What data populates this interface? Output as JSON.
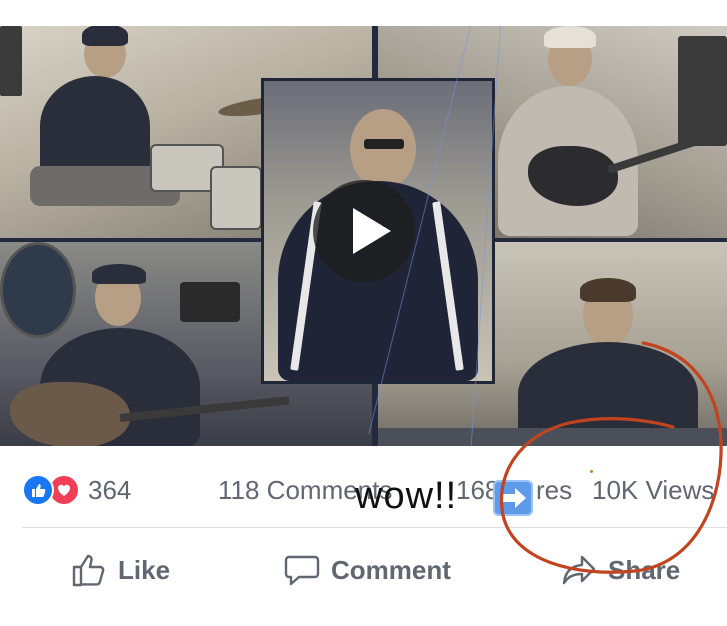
{
  "post": {
    "video": {
      "play_button_label": "Play"
    },
    "reactions": {
      "count": "364",
      "types": [
        "like",
        "love"
      ]
    },
    "stats": {
      "comments": "118 Comments",
      "shares_partial_1": "168 S",
      "shares_partial_2": "res",
      "views": "10K Views"
    },
    "annotation": {
      "text": "wow!!",
      "emoji": "right-arrow-emoji",
      "circle_color": "#c2441f"
    },
    "actions": {
      "like_label": "Like",
      "comment_label": "Comment",
      "share_label": "Share"
    }
  },
  "colors": {
    "facebook_blue": "#1877f2",
    "love_red": "#f33e58",
    "secondary_text": "#606770",
    "annotation_red": "#c2441f"
  }
}
